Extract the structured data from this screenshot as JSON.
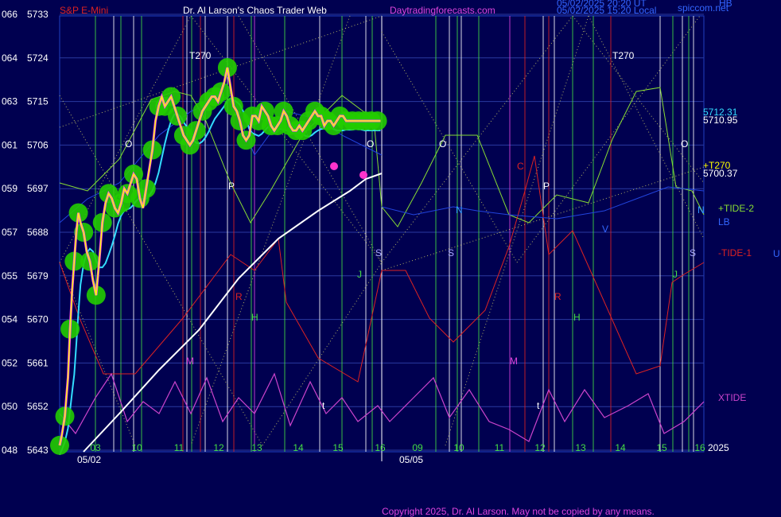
{
  "header": {
    "instrument": "S&P E-Mini",
    "title": "Dr. Al Larson's Chaos Trader Web",
    "site": "Daytradingforecasts.com",
    "timestamp1": "05/02/2025 20:20 UT",
    "timestamp2": "05/02/2025 15:20 Local",
    "corner_site": "spiccom.net",
    "corner_hb": "HB"
  },
  "footer": {
    "copyright": "Copyright 2025, Dr. Al Larson. May not be copied by any means."
  },
  "colors": {
    "background": "#000050",
    "grid": "#2040c0",
    "price_glow": "#22cc00",
    "price_line": "#ffff00",
    "price_core": "#ff44ff",
    "ma_fast": "#33ddff",
    "ma_slow": "#ffffff",
    "tide1": "#dd2222",
    "tide2": "#88dd33",
    "xtide": "#cc44cc",
    "label_red": "#dd2222",
    "label_green": "#44dd44",
    "label_blue": "#3366ff",
    "label_magenta": "#dd44dd",
    "label_white": "#ffffff"
  },
  "chart_data": {
    "type": "line",
    "title": "S&P E-Mini",
    "ylim": [
      5643,
      5733
    ],
    "y_ticks": [
      {
        "left": "066",
        "price": 5733
      },
      {
        "left": "064",
        "price": 5724
      },
      {
        "left": "063",
        "price": 5715
      },
      {
        "left": "061",
        "price": 5706
      },
      {
        "left": "059",
        "price": 5697
      },
      {
        "left": "057",
        "price": 5688
      },
      {
        "left": "055",
        "price": 5679
      },
      {
        "left": "054",
        "price": 5670
      },
      {
        "left": "052",
        "price": 5661
      },
      {
        "left": "050",
        "price": 5652
      },
      {
        "left": "048",
        "price": 5643
      }
    ],
    "x_hour_ticks": [
      "03",
      "10",
      "11",
      "12",
      "13",
      "14",
      "15",
      "16",
      "09",
      "10",
      "11",
      "12",
      "13",
      "14",
      "15",
      "16"
    ],
    "x_date_labels": [
      "05/02",
      "05/05"
    ],
    "year_label": "2025",
    "price_labels": {
      "p1": "5712.31",
      "p2": "5710.95",
      "p3": "5700.37",
      "t270_marker": "+T270"
    },
    "right_legend": [
      {
        "text": "+TIDE-2",
        "color": "#88dd33"
      },
      {
        "text": "LB",
        "color": "#3366ff"
      },
      {
        "text": "-TIDE-1",
        "color": "#dd2222"
      },
      {
        "text": "U",
        "color": "#3366ff"
      },
      {
        "text": "XTIDE",
        "color": "#cc44cc"
      }
    ],
    "chart_letters": [
      {
        "text": "T270",
        "color": "#ffffff"
      },
      {
        "text": "T270",
        "color": "#ffffff"
      },
      {
        "text": "O",
        "color": "#ffffff"
      },
      {
        "text": "O",
        "color": "#ffffff"
      },
      {
        "text": "O",
        "color": "#ffffff"
      },
      {
        "text": "O",
        "color": "#ffffff"
      },
      {
        "text": "P",
        "color": "#ffffff"
      },
      {
        "text": "P",
        "color": "#ffffff"
      },
      {
        "text": "R",
        "color": "#dd2222"
      },
      {
        "text": "R",
        "color": "#dd2222"
      },
      {
        "text": "H",
        "color": "#44dd44"
      },
      {
        "text": "H",
        "color": "#44dd44"
      },
      {
        "text": "M",
        "color": "#dd44dd"
      },
      {
        "text": "M",
        "color": "#dd44dd"
      },
      {
        "text": "N",
        "color": "#3399ff"
      },
      {
        "text": "N",
        "color": "#3399ff"
      },
      {
        "text": "S",
        "color": "#aaaaff"
      },
      {
        "text": "S",
        "color": "#aaaaff"
      },
      {
        "text": "S",
        "color": "#aaaaff"
      },
      {
        "text": "J",
        "color": "#44dd44"
      },
      {
        "text": "J",
        "color": "#44dd44"
      },
      {
        "text": "C",
        "color": "#dd2222"
      },
      {
        "text": "V",
        "color": "#3366ff"
      },
      {
        "text": "t",
        "color": "#ffffff"
      },
      {
        "text": "t",
        "color": "#ffffff"
      }
    ],
    "series": [
      {
        "name": "Price",
        "x": [
          0,
          2,
          5,
          8,
          10,
          12,
          14,
          16,
          18,
          20,
          23,
          26,
          29,
          32,
          35,
          38,
          41,
          44,
          47,
          50,
          53,
          56,
          59,
          62,
          65,
          68,
          71,
          74,
          77,
          80,
          83,
          86,
          89,
          92,
          95,
          98,
          101,
          104,
          107,
          110,
          113,
          116,
          119,
          122,
          125,
          128,
          131,
          134,
          137,
          140,
          143,
          146,
          149,
          152,
          155,
          158,
          161,
          164,
          167,
          170,
          173,
          176,
          179,
          182,
          185,
          188,
          191,
          194,
          197,
          200,
          203,
          206,
          209,
          212,
          215,
          218,
          221,
          224,
          227,
          230,
          233,
          236,
          239,
          242,
          245,
          248,
          251,
          254,
          257,
          260,
          263,
          266,
          269,
          272,
          275,
          278,
          281,
          284,
          287,
          290,
          293,
          296,
          299,
          302,
          305,
          308
        ],
        "values": [
          5644,
          5646,
          5650,
          5658,
          5668,
          5676,
          5682,
          5688,
          5692,
          5690,
          5688,
          5684,
          5682,
          5678,
          5675,
          5682,
          5690,
          5694,
          5696,
          5695,
          5693,
          5692,
          5694,
          5697,
          5696,
          5698,
          5700,
          5699,
          5695,
          5693,
          5697,
          5701,
          5705,
          5711,
          5714,
          5716,
          5714,
          5715,
          5716,
          5714,
          5712,
          5710,
          5708,
          5707,
          5706,
          5707,
          5709,
          5711,
          5713,
          5714,
          5715,
          5716,
          5716,
          5715,
          5717,
          5719,
          5722,
          5718,
          5714,
          5713,
          5711,
          5708,
          5707,
          5708,
          5712,
          5712,
          5711,
          5714,
          5713,
          5712,
          5710,
          5709,
          5710,
          5711,
          5713,
          5712,
          5710,
          5709,
          5709,
          5710,
          5709,
          5710,
          5711,
          5712,
          5713,
          5712,
          5712,
          5710,
          5711,
          5711,
          5710,
          5711,
          5712,
          5712,
          5711,
          5711,
          5711,
          5711,
          5711,
          5711,
          5711,
          5711,
          5711,
          5711,
          5711,
          5711
        ],
        "color": "#ffff00"
      }
    ]
  }
}
